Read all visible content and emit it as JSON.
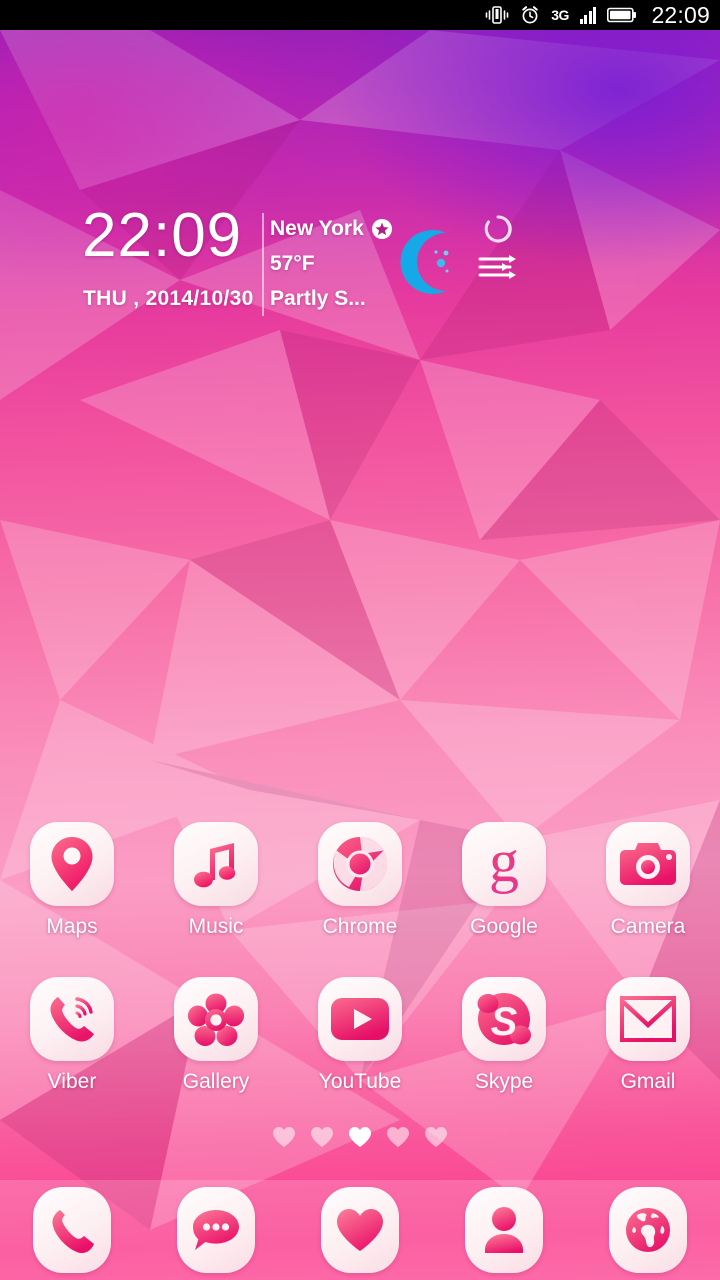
{
  "statusbar": {
    "time": "22:09",
    "network_label": "3G",
    "icons": [
      "vibrate-icon",
      "alarm-icon",
      "signal-icon",
      "battery-icon"
    ]
  },
  "widget": {
    "time": "22:09",
    "date": "THU , 2014/10/30",
    "city": "New York",
    "temperature": "57°F",
    "condition": "Partly S...",
    "moon_icon": "crescent-moon-icon",
    "refresh_icon": "refresh-icon",
    "settings_icon": "sliders-icon",
    "star_icon": "star-badge-icon",
    "moon_color": "#1ea8e0",
    "text_color": "#ffffff"
  },
  "grid": {
    "rows": [
      [
        {
          "label": "Maps",
          "icon": "maps-pin-icon"
        },
        {
          "label": "Music",
          "icon": "music-note-icon"
        },
        {
          "label": "Chrome",
          "icon": "chrome-icon"
        },
        {
          "label": "Google",
          "icon": "google-g-icon"
        },
        {
          "label": "Camera",
          "icon": "camera-icon"
        }
      ],
      [
        {
          "label": "Viber",
          "icon": "viber-phone-icon"
        },
        {
          "label": "Gallery",
          "icon": "flower-icon"
        },
        {
          "label": "YouTube",
          "icon": "youtube-icon"
        },
        {
          "label": "Skype",
          "icon": "skype-icon"
        },
        {
          "label": "Gmail",
          "icon": "gmail-envelope-icon"
        }
      ]
    ]
  },
  "page_indicator": {
    "count": 5,
    "active_index": 2,
    "shape": "heart"
  },
  "dock": {
    "items": [
      {
        "name": "Phone",
        "icon": "phone-handset-icon"
      },
      {
        "name": "Messages",
        "icon": "chat-bubble-icon"
      },
      {
        "name": "Favorites",
        "icon": "heart-icon"
      },
      {
        "name": "Contacts",
        "icon": "person-icon"
      },
      {
        "name": "Browser",
        "icon": "globe-icon"
      }
    ]
  },
  "theme": {
    "accent_pink": "#f4376f",
    "accent_light": "#fa6a8e",
    "wallpaper_top": "#8c1fb5",
    "wallpaper_mid": "#fa8ebb",
    "wallpaper_bottom": "#fd4b96",
    "tile_white": "#fffdfd"
  }
}
